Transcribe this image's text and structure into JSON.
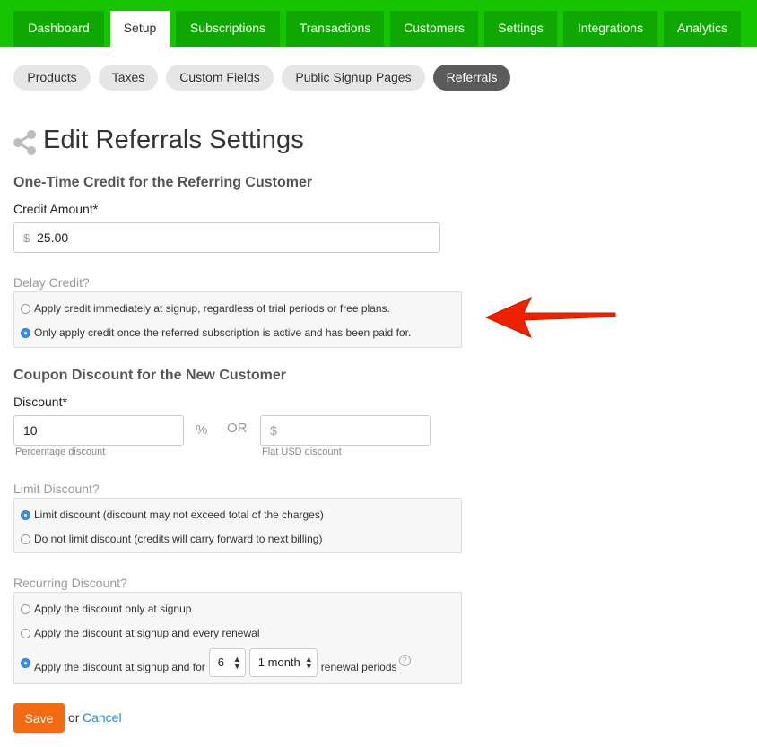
{
  "topnav": {
    "tabs": [
      {
        "label": "Dashboard"
      },
      {
        "label": "Setup"
      },
      {
        "label": "Subscriptions"
      },
      {
        "label": "Transactions"
      },
      {
        "label": "Customers"
      },
      {
        "label": "Settings"
      },
      {
        "label": "Integrations"
      },
      {
        "label": "Analytics"
      }
    ],
    "active": "Setup"
  },
  "subnav": {
    "items": [
      {
        "label": "Products"
      },
      {
        "label": "Taxes"
      },
      {
        "label": "Custom Fields"
      },
      {
        "label": "Public Signup Pages"
      },
      {
        "label": "Referrals"
      }
    ],
    "active": "Referrals"
  },
  "page": {
    "title": "Edit Referrals Settings",
    "icon": "share-icon"
  },
  "credit_section": {
    "heading": "One-Time Credit for the Referring Customer",
    "amount_label": "Credit Amount*",
    "currency_prefix": "$",
    "amount_value": "25.00",
    "delay_label": "Delay Credit?",
    "options": [
      {
        "label": "Apply credit immediately at signup, regardless of trial periods or free plans.",
        "checked": false
      },
      {
        "label": "Only apply credit once the referred subscription is active and has been paid for.",
        "checked": true
      }
    ]
  },
  "coupon_section": {
    "heading": "Coupon Discount for the New Customer",
    "discount_label": "Discount*",
    "percent_value": "10",
    "percent_symbol": "%",
    "or_text": "OR",
    "flat_prefix": "$",
    "flat_value": "",
    "percent_helper": "Percentage discount",
    "flat_helper": "Flat USD discount",
    "limit_label": "Limit Discount?",
    "limit_options": [
      {
        "label": "Limit discount (discount may not exceed total of the charges)",
        "checked": true
      },
      {
        "label": "Do not limit discount (credits will carry forward to next billing)",
        "checked": false
      }
    ],
    "recurring_label": "Recurring Discount?",
    "recurring_options": [
      {
        "label": "Apply the discount only at signup",
        "checked": false
      },
      {
        "label": "Apply the discount at signup and every renewal",
        "checked": false
      },
      {
        "label": "Apply the discount at signup and for",
        "checked": true
      }
    ],
    "renewal_count": "6",
    "renewal_period": "1 month",
    "renewal_suffix": "renewal periods"
  },
  "actions": {
    "save_label": "Save",
    "or_text": "or",
    "cancel_label": "Cancel"
  },
  "colors": {
    "nav_green": "#17c400",
    "tab_green": "#0fa800",
    "save_orange": "#f26a12",
    "link_blue": "#2f86d6",
    "annotation_red": "#ee2200"
  }
}
